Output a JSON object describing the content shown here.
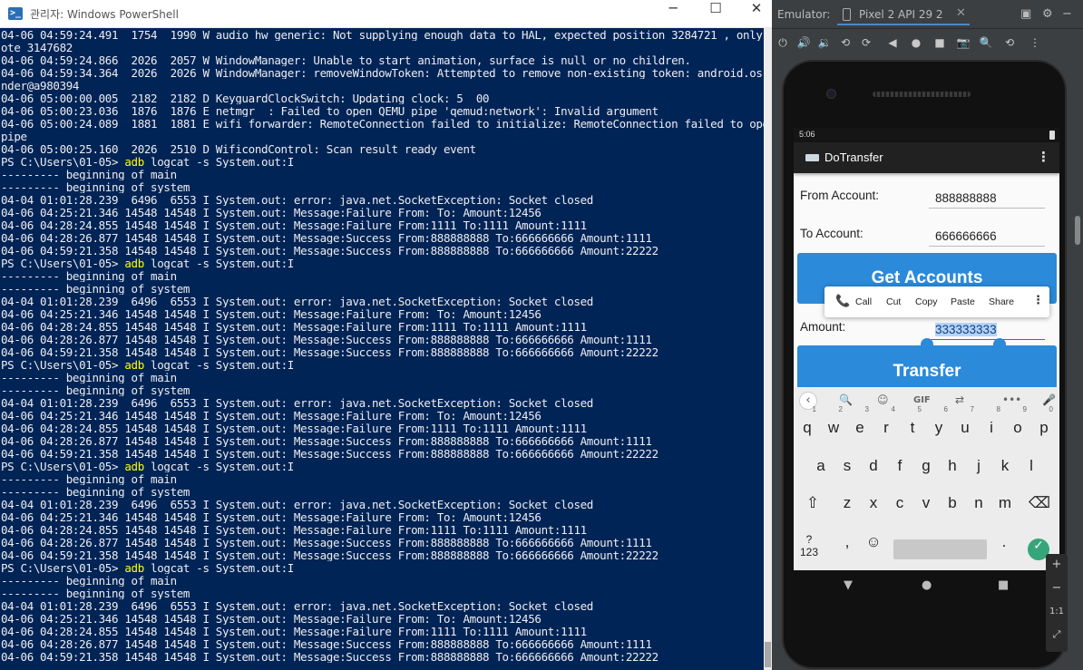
{
  "powershell": {
    "title": "관리자: Windows PowerShell",
    "icon_label": ">_",
    "minimize": "─",
    "maximize": "☐",
    "close": "✕",
    "lines": [
      [
        "ote 3147682"
      ],
      [
        "04-06 04:59:24.866  2026  2057 W WindowManager: Unable to start animation, surface is null or no children."
      ],
      [
        "04-06 04:59:34.364  2026  2026 W WindowManager: removeWindowToken: Attempted to remove non-existing token: android.os.Bi"
      ],
      [
        "nder@a980394"
      ],
      [
        "04-06 05:00:00.005  2182  2182 D KeyguardClockSwitch: Updating clock: 5  00"
      ],
      [
        "04-06 05:00:23.036  1876  1876 E netmgr  : Failed to open QEMU pipe 'qemud:network': Invalid argument"
      ],
      [
        "04-06 05:00:24.089  1881  1881 E wifi_forwarder: RemoteConnection failed to initialize: RemoteConnection failed to open"
      ],
      [
        "pipe"
      ],
      [
        "04-06 05:00:25.160  2026  2510 D WificondControl: Scan result ready event"
      ],
      [
        "PS C:\\Users\\01-05> ",
        "adb",
        " logcat -s System.out:I"
      ],
      [
        "--------- beginning of main"
      ],
      [
        "--------- beginning of system"
      ],
      [
        "04-04 01:01:28.239  6496  6553 I System.out: error: java.net.SocketException: Socket closed"
      ],
      [
        "04-06 04:25:21.346 14548 14548 I System.out: Message:Failure From: To: Amount:12456"
      ],
      [
        "04-06 04:28:24.855 14548 14548 I System.out: Message:Failure From:1111 To:1111 Amount:1111"
      ],
      [
        "04-06 04:28:26.877 14548 14548 I System.out: Message:Success From:888888888 To:666666666 Amount:1111"
      ],
      [
        "04-06 04:59:21.358 14548 14548 I System.out: Message:Success From:888888888 To:666666666 Amount:22222"
      ],
      [
        "PS C:\\Users\\01-05> ",
        "adb",
        " logcat -s System.out:I"
      ],
      [
        "--------- beginning of main"
      ],
      [
        "--------- beginning of system"
      ],
      [
        "04-04 01:01:28.239  6496  6553 I System.out: error: java.net.SocketException: Socket closed"
      ],
      [
        "04-06 04:25:21.346 14548 14548 I System.out: Message:Failure From: To: Amount:12456"
      ],
      [
        "04-06 04:28:24.855 14548 14548 I System.out: Message:Failure From:1111 To:1111 Amount:1111"
      ],
      [
        "04-06 04:28:26.877 14548 14548 I System.out: Message:Success From:888888888 To:666666666 Amount:1111"
      ],
      [
        "04-06 04:59:21.358 14548 14548 I System.out: Message:Success From:888888888 To:666666666 Amount:22222"
      ],
      [
        "PS C:\\Users\\01-05> ",
        "adb",
        " logcat -s System.out:I"
      ],
      [
        "--------- beginning of main"
      ],
      [
        "--------- beginning of system"
      ],
      [
        "04-04 01:01:28.239  6496  6553 I System.out: error: java.net.SocketException: Socket closed"
      ],
      [
        "04-06 04:25:21.346 14548 14548 I System.out: Message:Failure From: To: Amount:12456"
      ],
      [
        "04-06 04:28:24.855 14548 14548 I System.out: Message:Failure From:1111 To:1111 Amount:1111"
      ],
      [
        "04-06 04:28:26.877 14548 14548 I System.out: Message:Success From:888888888 To:666666666 Amount:1111"
      ],
      [
        "04-06 04:59:21.358 14548 14548 I System.out: Message:Success From:888888888 To:666666666 Amount:22222"
      ],
      [
        "PS C:\\Users\\01-05> ",
        "adb",
        " logcat -s System.out:I"
      ],
      [
        "--------- beginning of main"
      ],
      [
        "--------- beginning of system"
      ],
      [
        "04-04 01:01:28.239  6496  6553 I System.out: error: java.net.SocketException: Socket closed"
      ],
      [
        "04-06 04:25:21.346 14548 14548 I System.out: Message:Failure From: To: Amount:12456"
      ],
      [
        "04-06 04:28:24.855 14548 14548 I System.out: Message:Failure From:1111 To:1111 Amount:1111"
      ],
      [
        "04-06 04:28:26.877 14548 14548 I System.out: Message:Success From:888888888 To:666666666 Amount:1111"
      ],
      [
        "04-06 04:59:21.358 14548 14548 I System.out: Message:Success From:888888888 To:666666666 Amount:22222"
      ],
      [
        "PS C:\\Users\\01-05> ",
        "adb",
        " logcat -s System.out:I"
      ],
      [
        "--------- beginning of main"
      ],
      [
        "--------- beginning of system"
      ],
      [
        "04-04 01:01:28.239  6496  6553 I System.out: error: java.net.SocketException: Socket closed"
      ],
      [
        "04-06 04:25:21.346 14548 14548 I System.out: Message:Failure From: To: Amount:12456"
      ],
      [
        "04-06 04:28:24.855 14548 14548 I System.out: Message:Failure From:1111 To:1111 Amount:1111"
      ],
      [
        "04-06 04:28:26.877 14548 14548 I System.out: Message:Success From:888888888 To:666666666 Amount:1111"
      ],
      [
        "04-06 04:59:21.358 14548 14548 I System.out: Message:Success From:888888888 To:666666666 Amount:22222"
      ]
    ],
    "top_line": "04-06 04:59:24.491  1754  1990 W audio_hw_generic: Not supplying enough data to HAL, expected position 3284721 , only wr"
  },
  "emulator": {
    "label": "Emulator:",
    "device_name": "Pixel 2 API 29 2",
    "device_close": "✕",
    "toolbar_icons": [
      "power-icon",
      "volume-up-icon",
      "volume-down-icon",
      "rotate-left-icon",
      "rotate-right-icon",
      "back-icon",
      "home-icon",
      "overview-icon",
      "camera-icon",
      "zoom-icon",
      "rewind-icon",
      "more-icon"
    ],
    "status_time": "5:06",
    "app_title": "DoTransfer",
    "from_label": "From Account:",
    "from_value": "888888888",
    "to_label": "To Account:",
    "to_value": "666666666",
    "get_accounts_label": "Get Accounts",
    "amount_label": "Amount:",
    "amount_value": "333333333",
    "transfer_label": "Transfer",
    "context_menu": [
      "Call",
      "Cut",
      "Copy",
      "Paste",
      "Share"
    ],
    "keyboard": {
      "row1": [
        "q",
        "w",
        "e",
        "r",
        "t",
        "y",
        "u",
        "i",
        "o",
        "p"
      ],
      "row1_hints": [
        "1",
        "2",
        "3",
        "4",
        "5",
        "6",
        "7",
        "8",
        "9",
        "0"
      ],
      "row2": [
        "a",
        "s",
        "d",
        "f",
        "g",
        "h",
        "j",
        "k",
        "l"
      ],
      "row3": [
        "z",
        "x",
        "c",
        "v",
        "b",
        "n",
        "m"
      ],
      "symbols_label": "?123",
      "comma": ",",
      "period": ".",
      "gif_label": "GIF"
    },
    "zoom": {
      "plus": "+",
      "minus": "−",
      "ratio": "1:1"
    }
  },
  "colors": {
    "console_bg": "#012456",
    "console_text": "#eeedf0",
    "accent_yellow": "#ffff00",
    "button_blue": "#2b8ad9",
    "appbar": "#212121",
    "enter_green": "#35a679"
  }
}
